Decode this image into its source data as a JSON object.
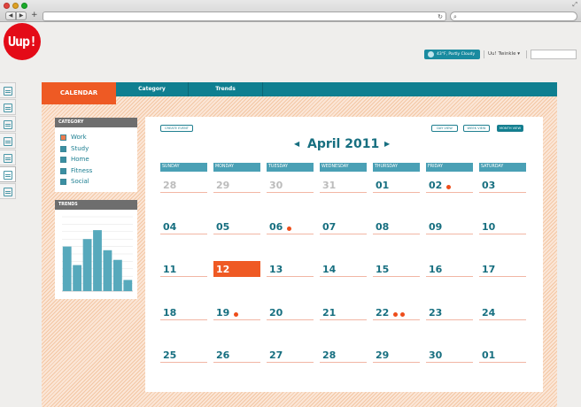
{
  "browser": {
    "new_tab_label": "+",
    "back_icon": "back-arrow-icon",
    "forward_icon": "forward-arrow-icon",
    "reload_icon": "reload-icon"
  },
  "logo": {
    "text": "Uup!",
    "color": "#e40b17"
  },
  "header": {
    "weather": "43°F, Partly Cloudy",
    "user": "Uu! Twinkle ▾"
  },
  "nav": {
    "calendar": "CALENDAR",
    "category": "Category",
    "trends": "Trends"
  },
  "category_panel": {
    "title": "CATEGORY",
    "items": [
      {
        "label": "Work",
        "color": "#ee7b4e"
      },
      {
        "label": "Study",
        "color": "#3b8fa2"
      },
      {
        "label": "Home",
        "color": "#3b8fa2"
      },
      {
        "label": "Fitness",
        "color": "#3b8fa2"
      },
      {
        "label": "Social",
        "color": "#3b8fa2"
      }
    ]
  },
  "trends_panel": {
    "title": "TRENDS"
  },
  "chart_data": {
    "type": "bar",
    "categories": [
      "",
      "",
      "",
      "",
      "",
      "",
      ""
    ],
    "values": [
      6,
      3.5,
      7,
      8.2,
      5.5,
      4.2,
      1.5
    ],
    "ylim": [
      0,
      10
    ],
    "grid": true,
    "color": "#57a9bc"
  },
  "calendar": {
    "create_event": "CREATE EVENT",
    "views": [
      "DAY VIEW",
      "WEEK VIEW",
      "MONTH VIEW"
    ],
    "active_view": "MONTH VIEW",
    "month_title": "April 2011",
    "prev": "◀",
    "next": "▶",
    "weekdays": [
      "SUNDAY",
      "MONDAY",
      "TUESDAY",
      "WEDNESDAY",
      "THURSDAY",
      "FRIDAY",
      "SATURDAY"
    ],
    "weeks": [
      [
        {
          "d": "28",
          "muted": true
        },
        {
          "d": "29",
          "muted": true
        },
        {
          "d": "30",
          "muted": true
        },
        {
          "d": "31",
          "muted": true
        },
        {
          "d": "01"
        },
        {
          "d": "02",
          "dots": 1
        },
        {
          "d": "03"
        }
      ],
      [
        {
          "d": "04"
        },
        {
          "d": "05"
        },
        {
          "d": "06",
          "dots": 1
        },
        {
          "d": "07"
        },
        {
          "d": "08"
        },
        {
          "d": "09"
        },
        {
          "d": "10"
        }
      ],
      [
        {
          "d": "11"
        },
        {
          "d": "12",
          "today": true
        },
        {
          "d": "13"
        },
        {
          "d": "14"
        },
        {
          "d": "15"
        },
        {
          "d": "16"
        },
        {
          "d": "17"
        }
      ],
      [
        {
          "d": "18"
        },
        {
          "d": "19",
          "dots": 1
        },
        {
          "d": "20"
        },
        {
          "d": "21"
        },
        {
          "d": "22",
          "dots": 2
        },
        {
          "d": "23"
        },
        {
          "d": "24"
        }
      ],
      [
        {
          "d": "25"
        },
        {
          "d": "26"
        },
        {
          "d": "27"
        },
        {
          "d": "28"
        },
        {
          "d": "29"
        },
        {
          "d": "30"
        },
        {
          "d": "01"
        }
      ]
    ]
  },
  "colors": {
    "accent": "#ee5a24",
    "teal": "#0f7f90",
    "today": "#ef5a24"
  }
}
